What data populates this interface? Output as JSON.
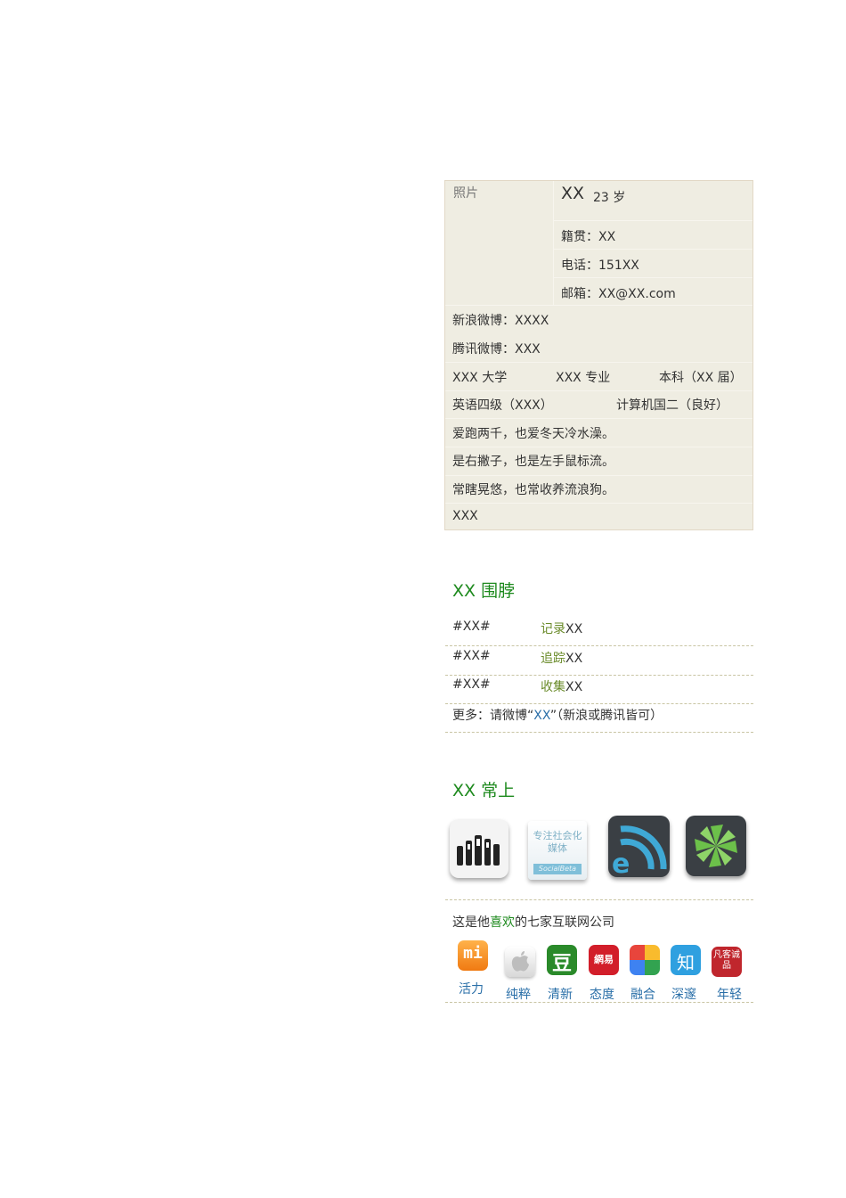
{
  "profile": {
    "photo_label": "照片",
    "name": "XX",
    "age": "23 岁",
    "hometown": "籍贯：XX",
    "phone": "电话：151XX",
    "email": "邮箱：XX@XX.com",
    "weibo_sina": "新浪微博：XXXX",
    "weibo_tencent": "腾讯微博：XXX",
    "university": "XXX 大学",
    "major": "XXX 专业",
    "degree": "本科（XX 届）",
    "english": "英语四级（XXX）",
    "computer": "计算机国二（良好）",
    "bio": [
      "爱跑两千，也爱冬天冷水澡。",
      "是右撇子，也是左手鼠标流。",
      "常瞎晃悠，也常收养流浪狗。",
      "XXX"
    ]
  },
  "scarf": {
    "title": "XX 围脖",
    "rows": [
      {
        "tag": "#XX#",
        "action": "记录",
        "object": "XX"
      },
      {
        "tag": "#XX#",
        "action": "追踪",
        "object": "XX"
      },
      {
        "tag": "#XX#",
        "action": "收集",
        "object": "XX"
      }
    ],
    "more_prefix": "更多：请微博“",
    "more_link": "XX",
    "more_suffix": "”（新浪或腾讯皆可）"
  },
  "frequent": {
    "title": "XX 常上",
    "sites": [
      "hands-logo-icon",
      "socialbeta-logo-icon",
      "rss-e-logo-icon",
      "green-pinwheel-logo-icon"
    ],
    "socialbeta_text": "专注社会化媒体",
    "socialbeta_brand": "SocialBeta",
    "companies_prefix": "这是他",
    "companies_highlight": "喜欢",
    "companies_suffix": "的七家互联网公司",
    "companies": [
      {
        "icon": "xiaomi-icon",
        "glyph": "mi",
        "label": "活力"
      },
      {
        "icon": "apple-icon",
        "glyph": "",
        "label": "纯粹"
      },
      {
        "icon": "douban-icon",
        "glyph": "豆",
        "label": "清新"
      },
      {
        "icon": "netease-icon",
        "glyph": "網易",
        "label": "态度"
      },
      {
        "icon": "google-icon",
        "glyph": "",
        "label": "融合"
      },
      {
        "icon": "zhihu-icon",
        "glyph": "知",
        "label": "深邃"
      },
      {
        "icon": "vancl-icon",
        "glyph": "凡客诚品",
        "label": "年轻"
      }
    ]
  }
}
